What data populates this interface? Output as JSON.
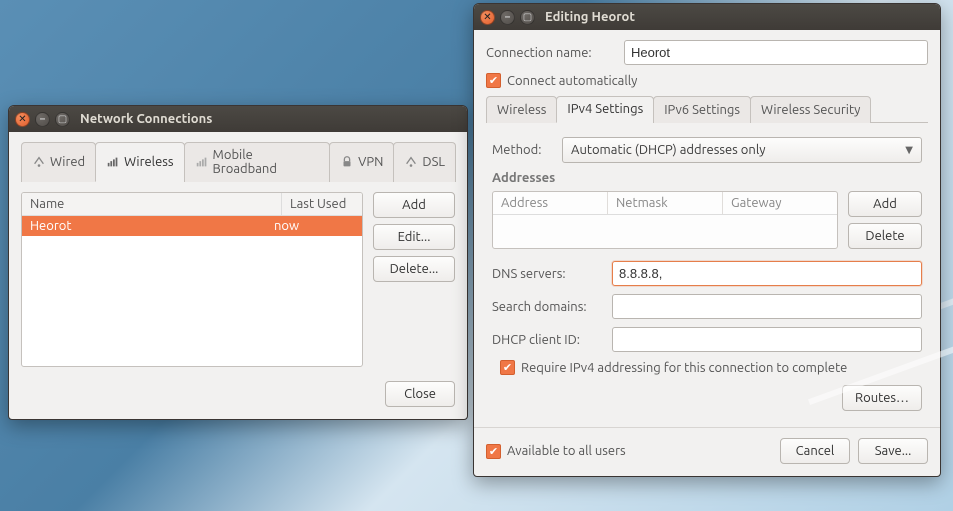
{
  "colors": {
    "accent": "#f07746"
  },
  "win1": {
    "title": "Network Connections",
    "tabs": [
      "Wired",
      "Wireless",
      "Mobile Broadband",
      "VPN",
      "DSL"
    ],
    "active_tab": 1,
    "list": {
      "col_name": "Name",
      "col_last": "Last Used",
      "rows": [
        {
          "name": "Heorot",
          "last": "now"
        }
      ]
    },
    "btn_add": "Add",
    "btn_edit": "Edit...",
    "btn_delete": "Delete...",
    "btn_close": "Close"
  },
  "win2": {
    "title": "Editing Heorot",
    "conn_name_label": "Connection name:",
    "conn_name_value": "Heorot",
    "connect_auto": "Connect automatically",
    "connect_auto_checked": true,
    "tabs": [
      "Wireless",
      "IPv4 Settings",
      "IPv6 Settings",
      "Wireless Security"
    ],
    "active_tab": 1,
    "method_label": "Method:",
    "method_value": "Automatic (DHCP) addresses only",
    "addresses_label": "Addresses",
    "addr_cols": {
      "address": "Address",
      "netmask": "Netmask",
      "gateway": "Gateway"
    },
    "btn_addr_add": "Add",
    "btn_addr_delete": "Delete",
    "dns_label": "DNS servers:",
    "dns_value": "8.8.8.8,",
    "search_label": "Search domains:",
    "search_value": "",
    "dhcp_label": "DHCP client ID:",
    "dhcp_value": "",
    "require_ipv4": "Require IPv4 addressing for this connection to complete",
    "require_ipv4_checked": true,
    "btn_routes": "Routes…",
    "avail_all": "Available to all users",
    "avail_all_checked": true,
    "btn_cancel": "Cancel",
    "btn_save": "Save..."
  }
}
